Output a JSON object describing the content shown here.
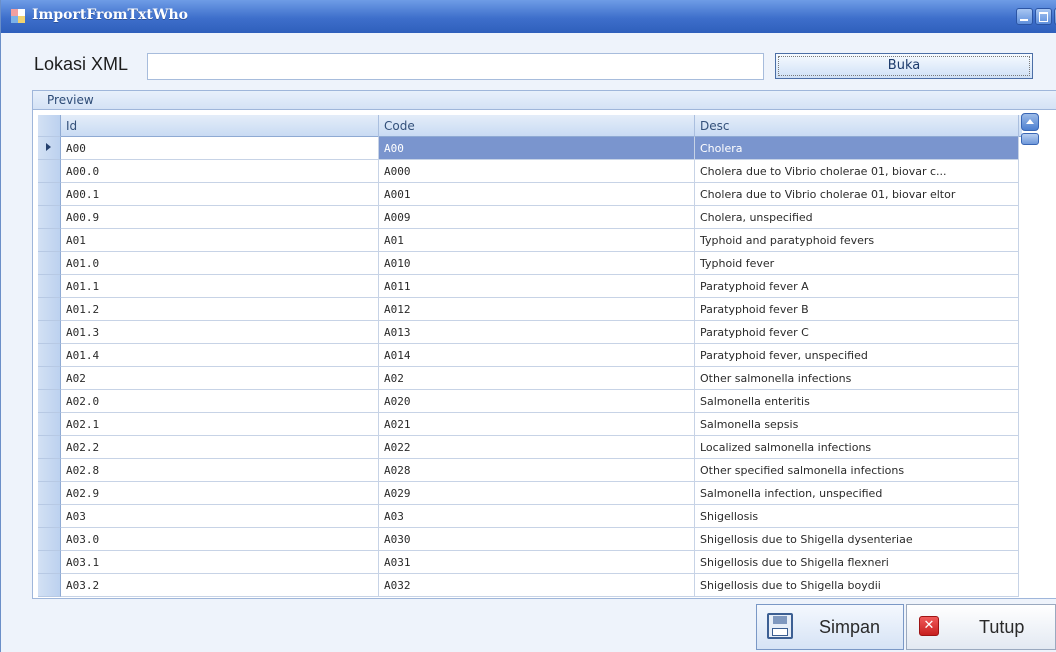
{
  "window": {
    "title": "ImportFromTxtWho"
  },
  "form": {
    "location_label": "Lokasi XML",
    "location_value": "",
    "open_button": "Buka"
  },
  "preview": {
    "label": "Preview",
    "columns": [
      "Id",
      "Code",
      "Desc"
    ],
    "selected_row": 0,
    "rows": [
      {
        "id": "A00",
        "code": "A00",
        "desc": "Cholera"
      },
      {
        "id": "A00.0",
        "code": "A000",
        "desc": "Cholera due to Vibrio cholerae 01, biovar c..."
      },
      {
        "id": "A00.1",
        "code": "A001",
        "desc": "Cholera due to Vibrio cholerae 01, biovar eltor"
      },
      {
        "id": "A00.9",
        "code": "A009",
        "desc": "Cholera, unspecified"
      },
      {
        "id": "A01",
        "code": "A01",
        "desc": "Typhoid and paratyphoid fevers"
      },
      {
        "id": "A01.0",
        "code": "A010",
        "desc": "Typhoid fever"
      },
      {
        "id": "A01.1",
        "code": "A011",
        "desc": "Paratyphoid fever A"
      },
      {
        "id": "A01.2",
        "code": "A012",
        "desc": "Paratyphoid fever B"
      },
      {
        "id": "A01.3",
        "code": "A013",
        "desc": "Paratyphoid fever C"
      },
      {
        "id": "A01.4",
        "code": "A014",
        "desc": "Paratyphoid fever, unspecified"
      },
      {
        "id": "A02",
        "code": "A02",
        "desc": "Other salmonella infections"
      },
      {
        "id": "A02.0",
        "code": "A020",
        "desc": "Salmonella enteritis"
      },
      {
        "id": "A02.1",
        "code": "A021",
        "desc": "Salmonella sepsis"
      },
      {
        "id": "A02.2",
        "code": "A022",
        "desc": "Localized salmonella infections"
      },
      {
        "id": "A02.8",
        "code": "A028",
        "desc": "Other specified salmonella infections"
      },
      {
        "id": "A02.9",
        "code": "A029",
        "desc": "Salmonella infection, unspecified"
      },
      {
        "id": "A03",
        "code": "A03",
        "desc": "Shigellosis"
      },
      {
        "id": "A03.0",
        "code": "A030",
        "desc": "Shigellosis due to Shigella dysenteriae"
      },
      {
        "id": "A03.1",
        "code": "A031",
        "desc": "Shigellosis due to Shigella flexneri"
      },
      {
        "id": "A03.2",
        "code": "A032",
        "desc": "Shigellosis due to Shigella boydii"
      }
    ]
  },
  "actions": {
    "save_label": "Simpan",
    "close_label": "Tutup"
  },
  "icons": {
    "app": "app-window-icon",
    "save": "floppy-disk-icon",
    "close": "red-x-icon"
  },
  "colors": {
    "titlebar": "#3e6fcb",
    "selected_row": "#7a95ce"
  }
}
